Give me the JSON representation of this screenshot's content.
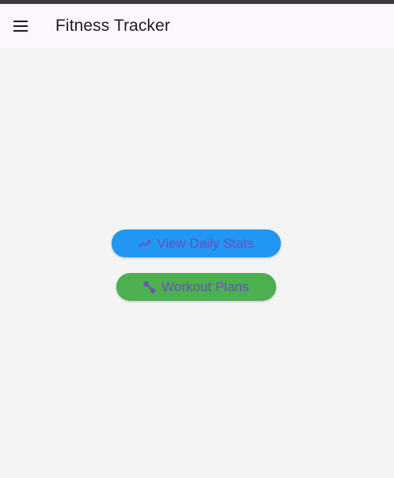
{
  "app_bar": {
    "title": "Fitness Tracker",
    "menu_icon": "menu-icon"
  },
  "actions": {
    "daily_stats": {
      "label": "View Daily Stats",
      "icon": "trending-up-icon",
      "background": "#2196f3"
    },
    "workout_plans": {
      "label": "Workout Plans",
      "icon": "fitness-center-icon",
      "background": "#4caf50"
    }
  },
  "colors": {
    "app_bar_background": "#fdf7fd",
    "page_background": "#f4f4f4",
    "button_text": "#6a4fbf",
    "title_text": "#1d1b20"
  }
}
